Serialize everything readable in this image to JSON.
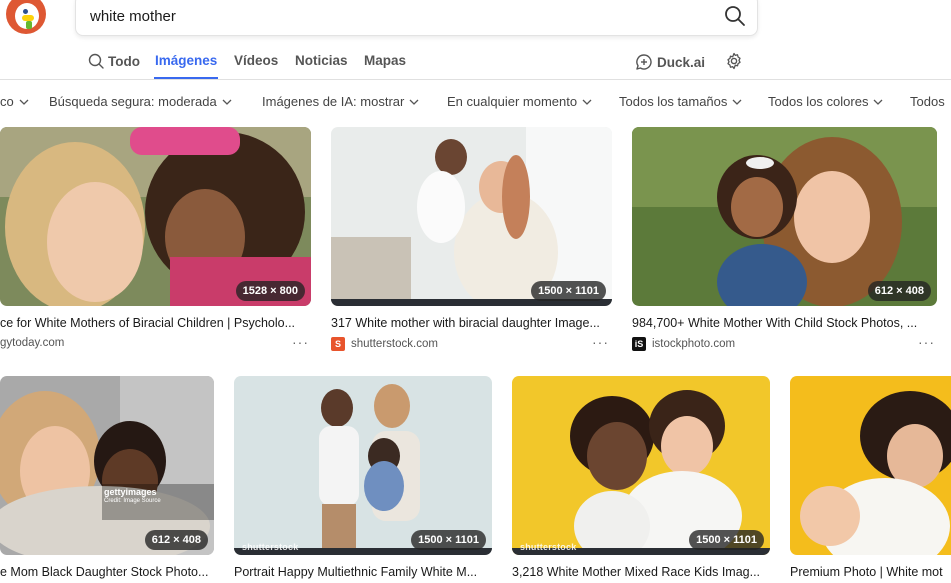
{
  "search": {
    "query": "white mother"
  },
  "tabs": [
    {
      "label": "Todo",
      "icon": "search-icon"
    },
    {
      "label": "Imágenes",
      "active": true
    },
    {
      "label": "Vídeos"
    },
    {
      "label": "Noticias"
    },
    {
      "label": "Mapas"
    },
    {
      "label": "Duck.ai",
      "icon": "chat-icon"
    }
  ],
  "filters": [
    {
      "label": "co"
    },
    {
      "label": "Búsqueda segura: moderada"
    },
    {
      "label": "Imágenes de IA: mostrar"
    },
    {
      "label": "En cualquier momento"
    },
    {
      "label": "Todos los tamaños"
    },
    {
      "label": "Todos los colores"
    },
    {
      "label": "Todos"
    }
  ],
  "results": [
    {
      "title": "ce for White Mothers of Biracial Children | Psycholo...",
      "source": "gytoday.com",
      "dims": "1528 × 800"
    },
    {
      "title": "317 White mother with biracial daughter Image...",
      "source": "shutterstock.com",
      "dims": "1500 × 1101",
      "watermark": "shutterstock"
    },
    {
      "title": "984,700+ White Mother With Child Stock Photos, ...",
      "source": "istockphoto.com",
      "dims": "612 × 408"
    },
    {
      "title": "e Mom Black Daughter Stock Photo...",
      "dims": "612 × 408",
      "getty": "gettyimages",
      "getty_credit": "Credit: Image Source"
    },
    {
      "title": "Portrait Happy Multiethnic Family White M...",
      "dims": "1500 × 1101",
      "watermark": "shutterstock"
    },
    {
      "title": "3,218 White Mother Mixed Race Kids Imag...",
      "dims": "1500 × 1101",
      "watermark": "shutterstock"
    },
    {
      "title": "Premium Photo | White mot"
    }
  ],
  "colors": {
    "accent": "#3969ef",
    "brand": "#de5833"
  }
}
